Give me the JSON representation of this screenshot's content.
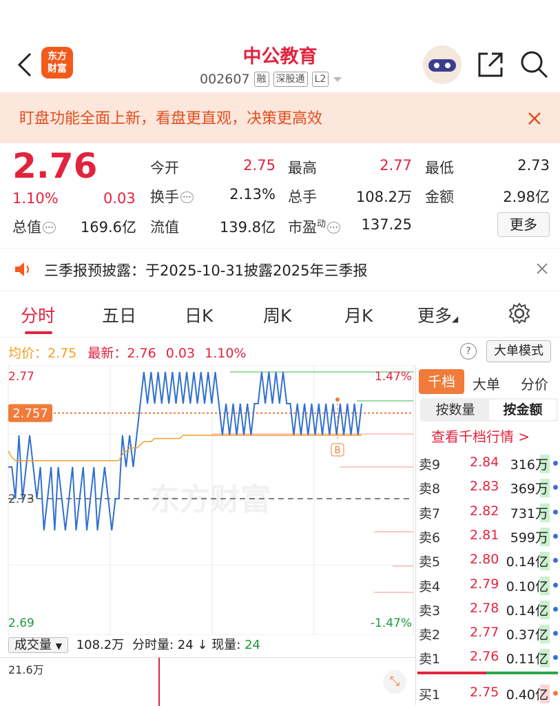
{
  "header": {
    "logo_text": "东方\n财富",
    "stock_name": "中公教育",
    "stock_code": "002607",
    "tags": [
      "融",
      "深股通",
      "L2"
    ]
  },
  "banner": {
    "text": "盯盘功能全面上新，看盘更直观，决策更高效"
  },
  "quote": {
    "price": "2.76",
    "change_pct": "1.10%",
    "change": "0.03",
    "market_cap_label": "总值",
    "market_cap": "169.6亿",
    "fields": [
      {
        "label": "今开",
        "value": "2.75",
        "color": "red"
      },
      {
        "label": "最高",
        "value": "2.77",
        "color": "red"
      },
      {
        "label": "最低",
        "value": "2.73",
        "color": "dark"
      },
      {
        "label": "换手",
        "value": "2.13%",
        "color": "dark"
      },
      {
        "label": "总手",
        "value": "108.2万",
        "color": "dark"
      },
      {
        "label": "金额",
        "value": "2.98亿",
        "color": "dark"
      },
      {
        "label": "流值",
        "value": "139.8亿",
        "color": "dark"
      },
      {
        "label": "市盈",
        "sup": "动",
        "value": "137.25",
        "color": "dark"
      }
    ],
    "more_button": "更多"
  },
  "notice": {
    "text": "三季报预披露：于2025-10-31披露2025年三季报"
  },
  "tabs": [
    "分时",
    "五日",
    "日K",
    "周K",
    "月K",
    "更多"
  ],
  "chart_info": {
    "avg_label": "均价：",
    "avg_value": "2.75",
    "latest_label": "最新：",
    "latest_value": "2.76",
    "latest_change": "0.03",
    "latest_pct": "1.10%",
    "big_order_mode": "大单模式",
    "help_icon": "?"
  },
  "chart_data": {
    "type": "line",
    "y_labels": {
      "top": "2.77",
      "mid": "2.73",
      "bottom": "2.69",
      "top_pct": "1.47%",
      "bottom_pct": "-1.47%",
      "current": "2.757"
    },
    "ylim": [
      2.69,
      2.77
    ],
    "prev_close": 2.73,
    "price": [
      2.74,
      2.74,
      2.73,
      2.75,
      2.73,
      2.74,
      2.75,
      2.74,
      2.73,
      2.74,
      2.72,
      2.73,
      2.74,
      2.72,
      2.74,
      2.73,
      2.72,
      2.73,
      2.74,
      2.72,
      2.73,
      2.74,
      2.72,
      2.73,
      2.74,
      2.72,
      2.73,
      2.74,
      2.73,
      2.72,
      2.73,
      2.73,
      2.75,
      2.74,
      2.75,
      2.74,
      2.75,
      2.76,
      2.77,
      2.76,
      2.77,
      2.76,
      2.77,
      2.76,
      2.77,
      2.76,
      2.77,
      2.76,
      2.77,
      2.76,
      2.77,
      2.76,
      2.77,
      2.76,
      2.77,
      2.76,
      2.77,
      2.76,
      2.77,
      2.76,
      2.75,
      2.76,
      2.75,
      2.76,
      2.75,
      2.76,
      2.75,
      2.76,
      2.75,
      2.76,
      2.76,
      2.77,
      2.76,
      2.77,
      2.76,
      2.77,
      2.76,
      2.77,
      2.76,
      2.76,
      2.75,
      2.76,
      2.75,
      2.76,
      2.75,
      2.76,
      2.75,
      2.76,
      2.75,
      2.76,
      2.75,
      2.76,
      2.75,
      2.76,
      2.75,
      2.76,
      2.75,
      2.76,
      2.75,
      2.76
    ],
    "avg": [
      2.745,
      2.743,
      2.742,
      2.742,
      2.742,
      2.742,
      2.742,
      2.742,
      2.742,
      2.742,
      2.742,
      2.742,
      2.742,
      2.742,
      2.742,
      2.742,
      2.742,
      2.742,
      2.742,
      2.742,
      2.742,
      2.742,
      2.742,
      2.742,
      2.742,
      2.742,
      2.742,
      2.742,
      2.742,
      2.742,
      2.742,
      2.742,
      2.744,
      2.745,
      2.746,
      2.746,
      2.746,
      2.747,
      2.748,
      2.748,
      2.748,
      2.749,
      2.749,
      2.749,
      2.749,
      2.749,
      2.749,
      2.749,
      2.749,
      2.75,
      2.75,
      2.75,
      2.75,
      2.75,
      2.75,
      2.75,
      2.75,
      2.75,
      2.75,
      2.75,
      2.75,
      2.75,
      2.75,
      2.75,
      2.75,
      2.75,
      2.75,
      2.75,
      2.75,
      2.75,
      2.75,
      2.75,
      2.75,
      2.75,
      2.75,
      2.75,
      2.75,
      2.75,
      2.75,
      2.75,
      2.75,
      2.75,
      2.75,
      2.75,
      2.75,
      2.75,
      2.75,
      2.75,
      2.75,
      2.75,
      2.75,
      2.75,
      2.75,
      2.75,
      2.75,
      2.75,
      2.75,
      2.75,
      2.75,
      2.75
    ],
    "current_price": 2.757,
    "watermark": "东方财富",
    "marker": "B"
  },
  "order_panel": {
    "tabs": [
      "千档",
      "大单",
      "分价"
    ],
    "segments": [
      "按数量",
      "按金额"
    ],
    "link": "查看千档行情 >",
    "asks": [
      {
        "label": "卖9",
        "price": "2.84",
        "vol": "316万"
      },
      {
        "label": "卖8",
        "price": "2.83",
        "vol": "369万"
      },
      {
        "label": "卖7",
        "price": "2.82",
        "vol": "731万"
      },
      {
        "label": "卖6",
        "price": "2.81",
        "vol": "599万"
      },
      {
        "label": "卖5",
        "price": "2.80",
        "vol": "0.14亿"
      },
      {
        "label": "卖4",
        "price": "2.79",
        "vol": "0.10亿"
      },
      {
        "label": "卖3",
        "price": "2.78",
        "vol": "0.14亿"
      },
      {
        "label": "卖2",
        "price": "2.77",
        "vol": "0.37亿"
      },
      {
        "label": "卖1",
        "price": "2.76",
        "vol": "0.11亿"
      }
    ],
    "bids": [
      {
        "label": "买1",
        "price": "2.75",
        "vol": "0.40亿"
      }
    ]
  },
  "volume": {
    "selector": "成交量",
    "total": "108.2万",
    "period_label": "分时量:",
    "period_value": "24",
    "now_label": "现量:",
    "now_value": "24",
    "axis_top": "21.6万"
  }
}
